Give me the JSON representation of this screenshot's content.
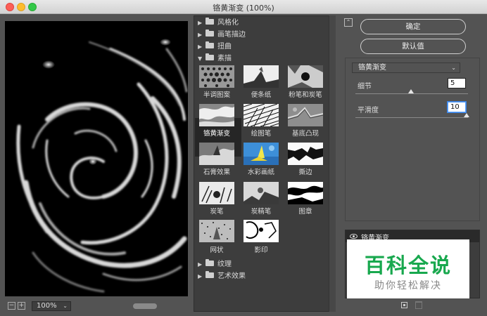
{
  "window": {
    "title": "铬黄渐变 (100%)"
  },
  "preview": {
    "zoom": "100%"
  },
  "gallery": {
    "categories": [
      {
        "label": "风格化",
        "expanded": false
      },
      {
        "label": "画笔描边",
        "expanded": false
      },
      {
        "label": "扭曲",
        "expanded": false
      },
      {
        "label": "素描",
        "expanded": true
      },
      {
        "label": "纹理",
        "expanded": false
      },
      {
        "label": "艺术效果",
        "expanded": false
      }
    ],
    "filters": [
      "半调图案",
      "便条纸",
      "粉笔和炭笔",
      "铬黄渐变",
      "绘图笔",
      "基底凸现",
      "石膏效果",
      "水彩画纸",
      "撕边",
      "炭笔",
      "炭精笔",
      "图章",
      "网状",
      "影印"
    ],
    "selected": "铬黄渐变"
  },
  "panel": {
    "ok_label": "确定",
    "default_label": "默认值",
    "filter_select": "铬黄渐变",
    "params": [
      {
        "label": "细节",
        "value": "5",
        "level": 0.5
      },
      {
        "label": "平滑度",
        "value": "10",
        "level": 1.0
      }
    ]
  },
  "layers": {
    "items": [
      "铬黄渐变"
    ]
  },
  "watermark": {
    "main": "百科全说",
    "sub": "助你轻松解决"
  }
}
